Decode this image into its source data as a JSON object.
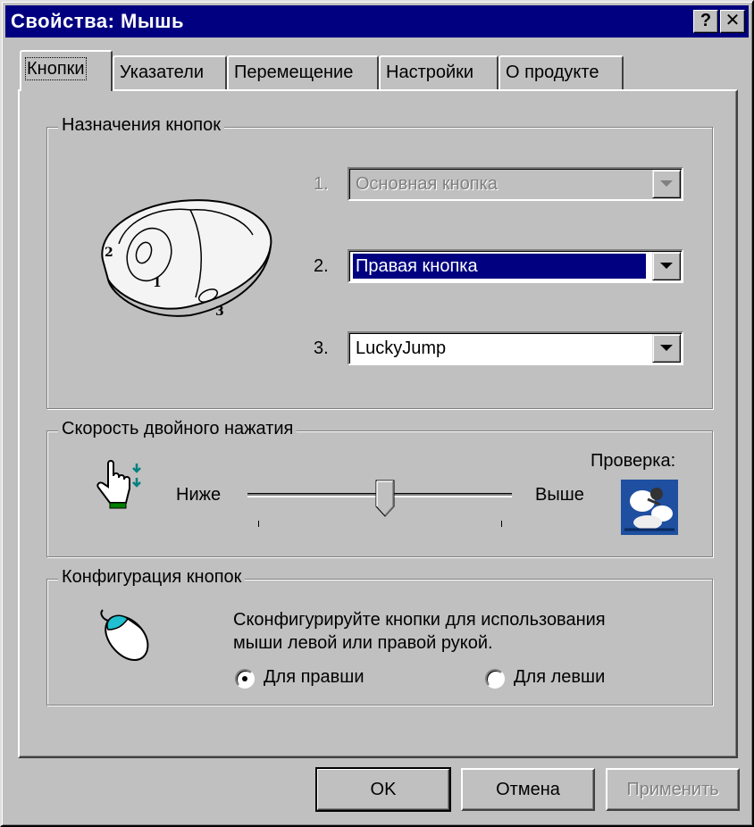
{
  "window": {
    "title": "Свойства: Мышь",
    "help_button": "?",
    "close_button": "✕"
  },
  "tabs": [
    {
      "label": "Кнопки",
      "active": true
    },
    {
      "label": "Указатели",
      "active": false
    },
    {
      "label": "Перемещение",
      "active": false
    },
    {
      "label": "Настройки",
      "active": false
    },
    {
      "label": "О продукте",
      "active": false
    }
  ],
  "button_assignment": {
    "title": "Назначения кнопок",
    "mouse_labels": [
      "1",
      "2",
      "3"
    ],
    "rows": [
      {
        "number": "1.",
        "value": "Основная кнопка",
        "state": "disabled"
      },
      {
        "number": "2.",
        "value": "Правая кнопка",
        "state": "selected"
      },
      {
        "number": "3.",
        "value": "LuckyJump",
        "state": "normal"
      }
    ]
  },
  "double_click": {
    "title": "Скорость двойного нажатия",
    "slower_label": "Ниже",
    "faster_label": "Выше",
    "test_label": "Проверка:",
    "speed_fraction": 0.5
  },
  "configuration": {
    "title": "Конфигурация кнопок",
    "description_line1": "Сконфигурируйте кнопки для использования",
    "description_line2": "мыши левой или правой рукой.",
    "right_hand_label": "Для правши",
    "left_hand_label": "Для левши",
    "selected": "right"
  },
  "buttons": {
    "ok": "OK",
    "cancel": "Отмена",
    "apply": "Применить"
  },
  "colors": {
    "titlebar": "#000080",
    "face": "#c0c0c0",
    "selection": "#000080",
    "test_icon_bg": "#1e4fa0"
  },
  "icons": {
    "mouse_illustration": "mouse-three-button-icon",
    "hand_pointer": "hand-pointer-icon",
    "test_area": "jack-in-the-box-icon",
    "small_mouse": "mouse-icon"
  }
}
